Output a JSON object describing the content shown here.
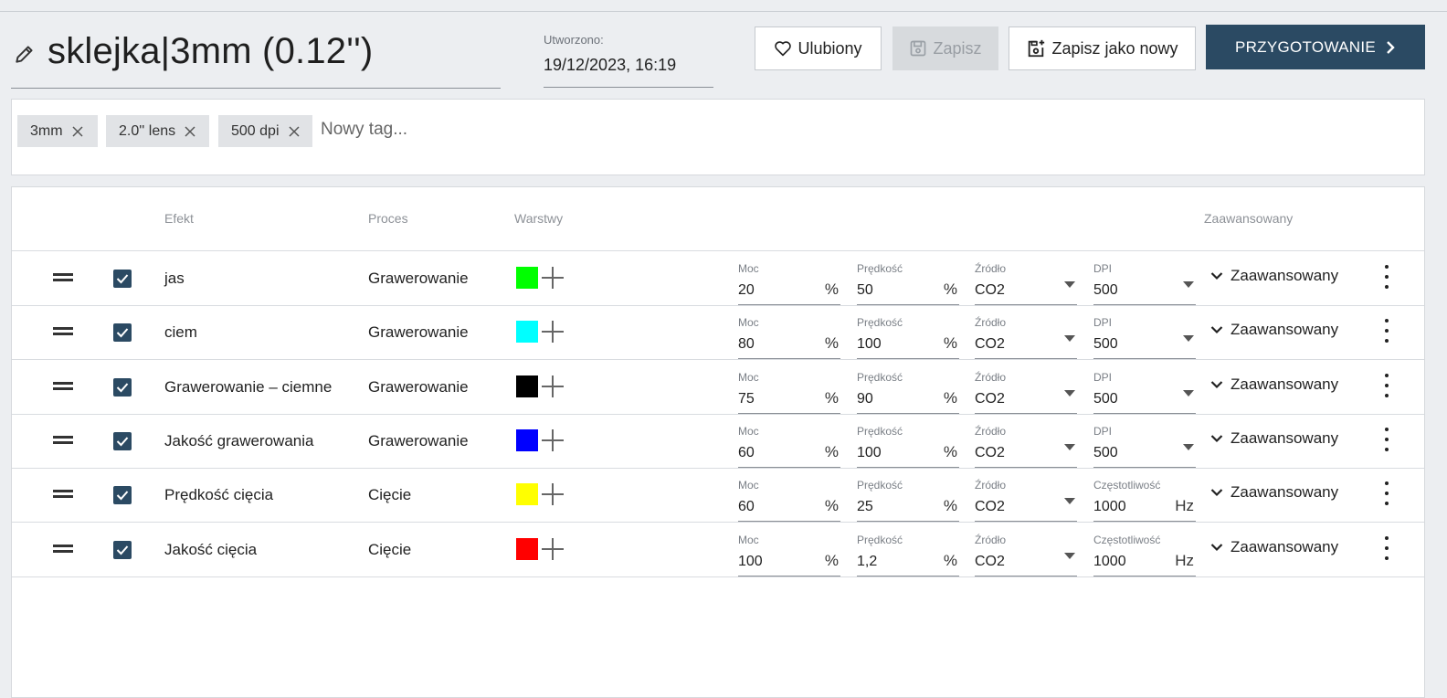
{
  "header": {
    "title": "sklejka|3mm (0.12'')",
    "created_label": "Utworzono:",
    "created_value": "19/12/2023, 16:19"
  },
  "buttons": {
    "favorite": "Ulubiony",
    "save": "Zapisz",
    "save_as_new": "Zapisz jako nowy",
    "prepare": "PRZYGOTOWANIE"
  },
  "tags": {
    "items": [
      "3mm",
      "2.0'' lens",
      "500 dpi"
    ],
    "new_placeholder": "Nowy tag..."
  },
  "table": {
    "headers": {
      "effect": "Efekt",
      "process": "Proces",
      "layers": "Warstwy",
      "advanced": "Zaawansowany"
    },
    "rows": [
      {
        "effect": "jas",
        "process": "Grawerowanie",
        "color": "#00ff00",
        "moc_label": "Moc",
        "moc": "20",
        "moc_unit": "%",
        "speed_label": "Prędkość",
        "speed": "50",
        "speed_unit": "%",
        "source_label": "Źródło",
        "source": "CO2",
        "last_label": "DPI",
        "last_value": "500",
        "last_unit": "",
        "last_type": "select",
        "advanced": "Zaawansowany",
        "checked": true
      },
      {
        "effect": "ciem",
        "process": "Grawerowanie",
        "color": "#00ffff",
        "moc_label": "Moc",
        "moc": "80",
        "moc_unit": "%",
        "speed_label": "Prędkość",
        "speed": "100",
        "speed_unit": "%",
        "source_label": "Źródło",
        "source": "CO2",
        "last_label": "DPI",
        "last_value": "500",
        "last_unit": "",
        "last_type": "select",
        "advanced": "Zaawansowany",
        "checked": true
      },
      {
        "effect": "Grawerowanie – ciemne",
        "process": "Grawerowanie",
        "color": "#000000",
        "moc_label": "Moc",
        "moc": "75",
        "moc_unit": "%",
        "speed_label": "Prędkość",
        "speed": "90",
        "speed_unit": "%",
        "source_label": "Źródło",
        "source": "CO2",
        "last_label": "DPI",
        "last_value": "500",
        "last_unit": "",
        "last_type": "select",
        "advanced": "Zaawansowany",
        "checked": true
      },
      {
        "effect": "Jakość grawerowania",
        "process": "Grawerowanie",
        "color": "#0000ff",
        "moc_label": "Moc",
        "moc": "60",
        "moc_unit": "%",
        "speed_label": "Prędkość",
        "speed": "100",
        "speed_unit": "%",
        "source_label": "Źródło",
        "source": "CO2",
        "last_label": "DPI",
        "last_value": "500",
        "last_unit": "",
        "last_type": "select",
        "advanced": "Zaawansowany",
        "checked": true
      },
      {
        "effect": "Prędkość cięcia",
        "process": "Cięcie",
        "color": "#ffff00",
        "moc_label": "Moc",
        "moc": "60",
        "moc_unit": "%",
        "speed_label": "Prędkość",
        "speed": "25",
        "speed_unit": "%",
        "source_label": "Źródło",
        "source": "CO2",
        "last_label": "Częstotliwość",
        "last_value": "1000",
        "last_unit": "Hz",
        "last_type": "input",
        "advanced": "Zaawansowany",
        "checked": true
      },
      {
        "effect": "Jakość cięcia",
        "process": "Cięcie",
        "color": "#ff0000",
        "moc_label": "Moc",
        "moc": "100",
        "moc_unit": "%",
        "speed_label": "Prędkość",
        "speed": "1,2",
        "speed_unit": "%",
        "source_label": "Źródło",
        "source": "CO2",
        "last_label": "Częstotliwość",
        "last_value": "1000",
        "last_unit": "Hz",
        "last_type": "input",
        "advanced": "Zaawansowany",
        "checked": true
      }
    ]
  },
  "icons": {
    "pencil": "pencil-icon",
    "heart": "heart-icon",
    "save": "save-icon",
    "save_as_new": "save-as-new-icon",
    "chevron_right": "chevron-right-icon",
    "close": "close-icon",
    "drag": "drag-handle-icon",
    "checkbox": "checkbox-checked-icon",
    "add": "plus-icon",
    "chevron_down": "chevron-down-icon",
    "caret": "caret-down-icon",
    "more": "more-vertical-icon"
  },
  "colors": {
    "accent": "#2b4a63",
    "background": "#eceef1",
    "disabled_button": "#d7dadd"
  }
}
